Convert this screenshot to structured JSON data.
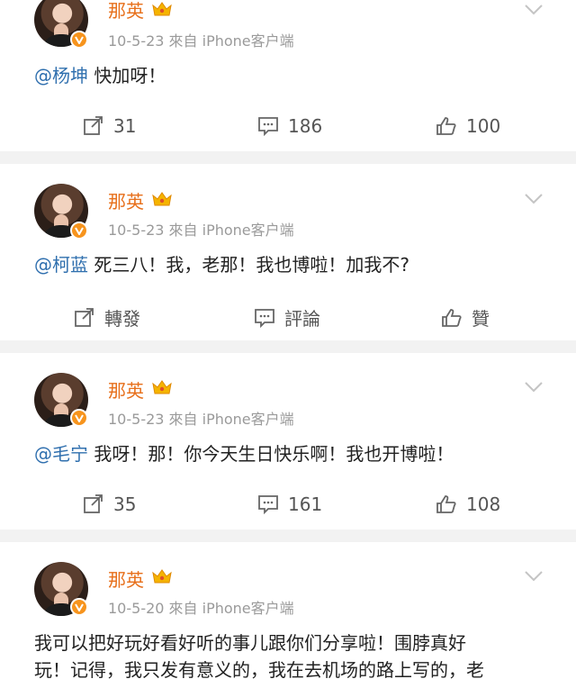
{
  "posts": [
    {
      "user": "那英",
      "meta": "10-5-23  來自 iPhone客户端",
      "mention": "@杨坤",
      "text": " 快加呀！",
      "actions": {
        "repost": "31",
        "comment": "186",
        "like": "100"
      }
    },
    {
      "user": "那英",
      "meta": "10-5-23  來自 iPhone客户端",
      "mention": "@柯蓝",
      "text": " 死三八！我，老那！我也博啦！加我不?",
      "actions": {
        "repost": "轉發",
        "comment": "評論",
        "like": "贊"
      }
    },
    {
      "user": "那英",
      "meta": "10-5-23  來自 iPhone客户端",
      "mention": "@毛宁",
      "text": " 我呀！那！你今天生日快乐啊！我也开博啦！",
      "actions": {
        "repost": "35",
        "comment": "161",
        "like": "108"
      }
    },
    {
      "user": "那英",
      "meta": "10-5-20  來自 iPhone客户端",
      "text_line1": "我可以把好玩好看好听的事儿跟你们分享啦！围脖真好",
      "text_line2": "玩！记得，我只发有意义的，我在去机场的路上写的，老"
    }
  ],
  "colors": {
    "name": "#e76f1a",
    "mention": "#2f6fae",
    "meta": "#9a9a9a",
    "gap": "#f2f2f2"
  },
  "icons": [
    "crown-badge-icon",
    "verified-v-icon",
    "chevron-down-icon",
    "repost-icon",
    "comment-icon",
    "like-icon"
  ]
}
